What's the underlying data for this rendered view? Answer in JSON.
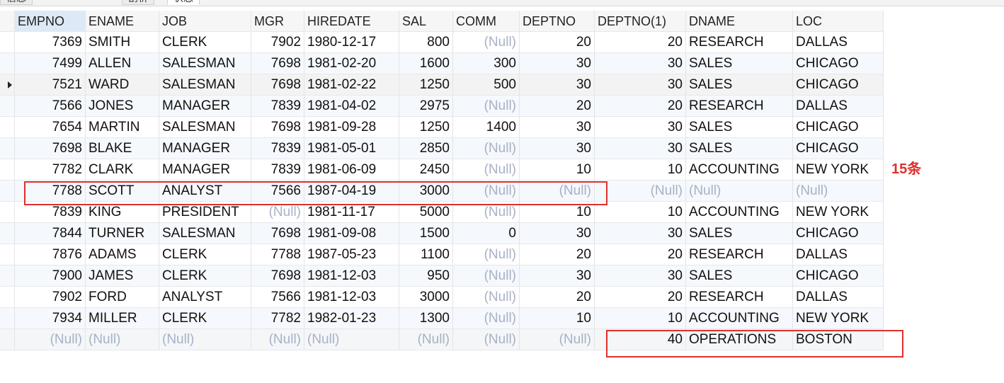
{
  "tabs": [
    "信息",
    "剖析",
    "状态"
  ],
  "columns": [
    "EMPNO",
    "ENAME",
    "JOB",
    "MGR",
    "HIREDATE",
    "SAL",
    "COMM",
    "DEPTNO",
    "DEPTNO(1)",
    "DNAME",
    "LOC"
  ],
  "rows": [
    [
      "7369",
      "SMITH",
      "CLERK",
      "7902",
      "1980-12-17",
      "800",
      "(Null)",
      "20",
      "20",
      "RESEARCH",
      "DALLAS"
    ],
    [
      "7499",
      "ALLEN",
      "SALESMAN",
      "7698",
      "1981-02-20",
      "1600",
      "300",
      "30",
      "30",
      "SALES",
      "CHICAGO"
    ],
    [
      "7521",
      "WARD",
      "SALESMAN",
      "7698",
      "1981-02-22",
      "1250",
      "500",
      "30",
      "30",
      "SALES",
      "CHICAGO"
    ],
    [
      "7566",
      "JONES",
      "MANAGER",
      "7839",
      "1981-04-02",
      "2975",
      "(Null)",
      "20",
      "20",
      "RESEARCH",
      "DALLAS"
    ],
    [
      "7654",
      "MARTIN",
      "SALESMAN",
      "7698",
      "1981-09-28",
      "1250",
      "1400",
      "30",
      "30",
      "SALES",
      "CHICAGO"
    ],
    [
      "7698",
      "BLAKE",
      "MANAGER",
      "7839",
      "1981-05-01",
      "2850",
      "(Null)",
      "30",
      "30",
      "SALES",
      "CHICAGO"
    ],
    [
      "7782",
      "CLARK",
      "MANAGER",
      "7839",
      "1981-06-09",
      "2450",
      "(Null)",
      "10",
      "10",
      "ACCOUNTING",
      "NEW YORK"
    ],
    [
      "7788",
      "SCOTT",
      "ANALYST",
      "7566",
      "1987-04-19",
      "3000",
      "(Null)",
      "(Null)",
      "(Null)",
      "(Null)",
      "(Null)"
    ],
    [
      "7839",
      "KING",
      "PRESIDENT",
      "(Null)",
      "1981-11-17",
      "5000",
      "(Null)",
      "10",
      "10",
      "ACCOUNTING",
      "NEW YORK"
    ],
    [
      "7844",
      "TURNER",
      "SALESMAN",
      "7698",
      "1981-09-08",
      "1500",
      "0",
      "30",
      "30",
      "SALES",
      "CHICAGO"
    ],
    [
      "7876",
      "ADAMS",
      "CLERK",
      "7788",
      "1987-05-23",
      "1100",
      "(Null)",
      "20",
      "20",
      "RESEARCH",
      "DALLAS"
    ],
    [
      "7900",
      "JAMES",
      "CLERK",
      "7698",
      "1981-12-03",
      "950",
      "(Null)",
      "30",
      "30",
      "SALES",
      "CHICAGO"
    ],
    [
      "7902",
      "FORD",
      "ANALYST",
      "7566",
      "1981-12-03",
      "3000",
      "(Null)",
      "20",
      "20",
      "RESEARCH",
      "DALLAS"
    ],
    [
      "7934",
      "MILLER",
      "CLERK",
      "7782",
      "1982-01-23",
      "1300",
      "(Null)",
      "10",
      "10",
      "ACCOUNTING",
      "NEW YORK"
    ],
    [
      "(Null)",
      "(Null)",
      "(Null)",
      "(Null)",
      "(Null)",
      "(Null)",
      "(Null)",
      "(Null)",
      "40",
      "OPERATIONS",
      "BOSTON"
    ]
  ],
  "annotation": "15条",
  "colors": {
    "annotation": "#e0302c",
    "null_text": "#a8b1c5",
    "header_selected": "#dde9f6"
  }
}
